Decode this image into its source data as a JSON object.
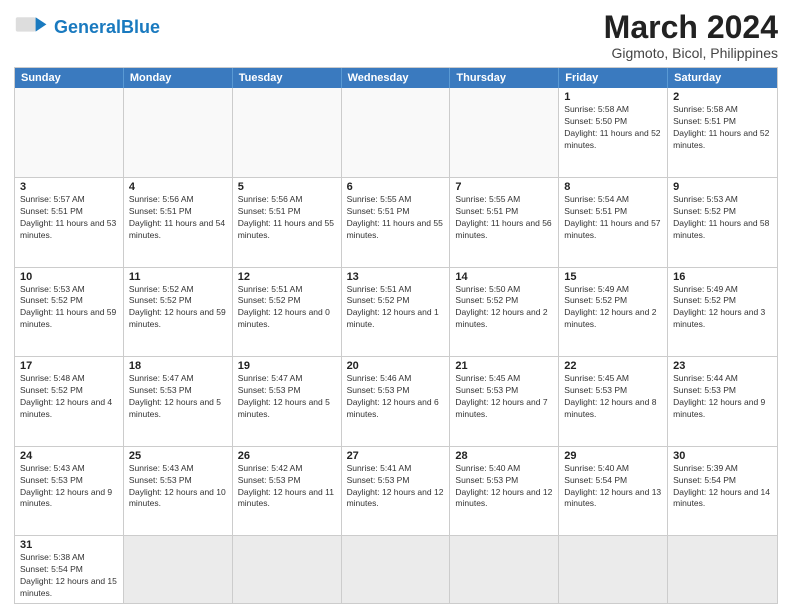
{
  "header": {
    "logo_general": "General",
    "logo_blue": "Blue",
    "month_title": "March 2024",
    "subtitle": "Gigmoto, Bicol, Philippines"
  },
  "weekdays": [
    "Sunday",
    "Monday",
    "Tuesday",
    "Wednesday",
    "Thursday",
    "Friday",
    "Saturday"
  ],
  "rows": [
    {
      "cells": [
        {
          "day": "",
          "empty": true
        },
        {
          "day": "",
          "empty": true
        },
        {
          "day": "",
          "empty": true
        },
        {
          "day": "",
          "empty": true
        },
        {
          "day": "",
          "empty": true
        },
        {
          "day": "1",
          "sunrise": "5:58 AM",
          "sunset": "5:50 PM",
          "daylight": "11 hours and 52 minutes."
        },
        {
          "day": "2",
          "sunrise": "5:58 AM",
          "sunset": "5:51 PM",
          "daylight": "11 hours and 52 minutes."
        }
      ]
    },
    {
      "cells": [
        {
          "day": "3",
          "sunrise": "5:57 AM",
          "sunset": "5:51 PM",
          "daylight": "11 hours and 53 minutes."
        },
        {
          "day": "4",
          "sunrise": "5:56 AM",
          "sunset": "5:51 PM",
          "daylight": "11 hours and 54 minutes."
        },
        {
          "day": "5",
          "sunrise": "5:56 AM",
          "sunset": "5:51 PM",
          "daylight": "11 hours and 55 minutes."
        },
        {
          "day": "6",
          "sunrise": "5:55 AM",
          "sunset": "5:51 PM",
          "daylight": "11 hours and 55 minutes."
        },
        {
          "day": "7",
          "sunrise": "5:55 AM",
          "sunset": "5:51 PM",
          "daylight": "11 hours and 56 minutes."
        },
        {
          "day": "8",
          "sunrise": "5:54 AM",
          "sunset": "5:51 PM",
          "daylight": "11 hours and 57 minutes."
        },
        {
          "day": "9",
          "sunrise": "5:53 AM",
          "sunset": "5:52 PM",
          "daylight": "11 hours and 58 minutes."
        }
      ]
    },
    {
      "cells": [
        {
          "day": "10",
          "sunrise": "5:53 AM",
          "sunset": "5:52 PM",
          "daylight": "11 hours and 59 minutes."
        },
        {
          "day": "11",
          "sunrise": "5:52 AM",
          "sunset": "5:52 PM",
          "daylight": "12 hours and 59 minutes."
        },
        {
          "day": "12",
          "sunrise": "5:51 AM",
          "sunset": "5:52 PM",
          "daylight": "12 hours and 0 minutes."
        },
        {
          "day": "13",
          "sunrise": "5:51 AM",
          "sunset": "5:52 PM",
          "daylight": "12 hours and 1 minute."
        },
        {
          "day": "14",
          "sunrise": "5:50 AM",
          "sunset": "5:52 PM",
          "daylight": "12 hours and 2 minutes."
        },
        {
          "day": "15",
          "sunrise": "5:49 AM",
          "sunset": "5:52 PM",
          "daylight": "12 hours and 2 minutes."
        },
        {
          "day": "16",
          "sunrise": "5:49 AM",
          "sunset": "5:52 PM",
          "daylight": "12 hours and 3 minutes."
        }
      ]
    },
    {
      "cells": [
        {
          "day": "17",
          "sunrise": "5:48 AM",
          "sunset": "5:52 PM",
          "daylight": "12 hours and 4 minutes."
        },
        {
          "day": "18",
          "sunrise": "5:47 AM",
          "sunset": "5:53 PM",
          "daylight": "12 hours and 5 minutes."
        },
        {
          "day": "19",
          "sunrise": "5:47 AM",
          "sunset": "5:53 PM",
          "daylight": "12 hours and 5 minutes."
        },
        {
          "day": "20",
          "sunrise": "5:46 AM",
          "sunset": "5:53 PM",
          "daylight": "12 hours and 6 minutes."
        },
        {
          "day": "21",
          "sunrise": "5:45 AM",
          "sunset": "5:53 PM",
          "daylight": "12 hours and 7 minutes."
        },
        {
          "day": "22",
          "sunrise": "5:45 AM",
          "sunset": "5:53 PM",
          "daylight": "12 hours and 8 minutes."
        },
        {
          "day": "23",
          "sunrise": "5:44 AM",
          "sunset": "5:53 PM",
          "daylight": "12 hours and 9 minutes."
        }
      ]
    },
    {
      "cells": [
        {
          "day": "24",
          "sunrise": "5:43 AM",
          "sunset": "5:53 PM",
          "daylight": "12 hours and 9 minutes."
        },
        {
          "day": "25",
          "sunrise": "5:43 AM",
          "sunset": "5:53 PM",
          "daylight": "12 hours and 10 minutes."
        },
        {
          "day": "26",
          "sunrise": "5:42 AM",
          "sunset": "5:53 PM",
          "daylight": "12 hours and 11 minutes."
        },
        {
          "day": "27",
          "sunrise": "5:41 AM",
          "sunset": "5:53 PM",
          "daylight": "12 hours and 12 minutes."
        },
        {
          "day": "28",
          "sunrise": "5:40 AM",
          "sunset": "5:53 PM",
          "daylight": "12 hours and 12 minutes."
        },
        {
          "day": "29",
          "sunrise": "5:40 AM",
          "sunset": "5:54 PM",
          "daylight": "12 hours and 13 minutes."
        },
        {
          "day": "30",
          "sunrise": "5:39 AM",
          "sunset": "5:54 PM",
          "daylight": "12 hours and 14 minutes."
        }
      ]
    }
  ],
  "last_row": {
    "cells": [
      {
        "day": "31",
        "sunrise": "5:38 AM",
        "sunset": "5:54 PM",
        "daylight": "12 hours and 15 minutes."
      },
      {
        "day": "",
        "empty": true
      },
      {
        "day": "",
        "empty": true
      },
      {
        "day": "",
        "empty": true
      },
      {
        "day": "",
        "empty": true
      },
      {
        "day": "",
        "empty": true
      },
      {
        "day": "",
        "empty": true
      }
    ]
  }
}
